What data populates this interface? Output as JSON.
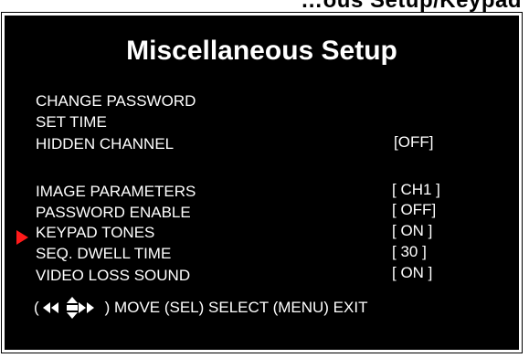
{
  "top_banner": {
    "text": "…ous Setup/Keypad"
  },
  "screen": {
    "title": "Miscellaneous Setup",
    "items": [
      {
        "label": "CHANGE PASSWORD",
        "value": ""
      },
      {
        "label": "SET TIME",
        "value": ""
      },
      {
        "label": "HIDDEN CHANNEL",
        "value": "[OFF]"
      },
      {
        "label": "IMAGE PARAMETERS",
        "value": "[ CH1 ]"
      },
      {
        "label": "PASSWORD ENABLE",
        "value": "[ OFF]"
      },
      {
        "label": "KEYPAD TONES",
        "value": "[ ON ]"
      },
      {
        "label": "SEQ. DWELL TIME",
        "value": "[ 30 ]"
      },
      {
        "label": "VIDEO LOSS SOUND",
        "value": "[ ON ]"
      }
    ],
    "selected_item": "KEYPAD TONES",
    "hint": {
      "open_paren": "(",
      "close_text": ") MOVE (SEL) SELECT   (MENU) EXIT"
    }
  },
  "colors": {
    "background": "#000000",
    "text": "#ffffff",
    "cursor": "#ff1a1a"
  },
  "icons": {
    "cursor": "red-triangle-pointer",
    "navigation": "left-up-down-right-arrows"
  }
}
